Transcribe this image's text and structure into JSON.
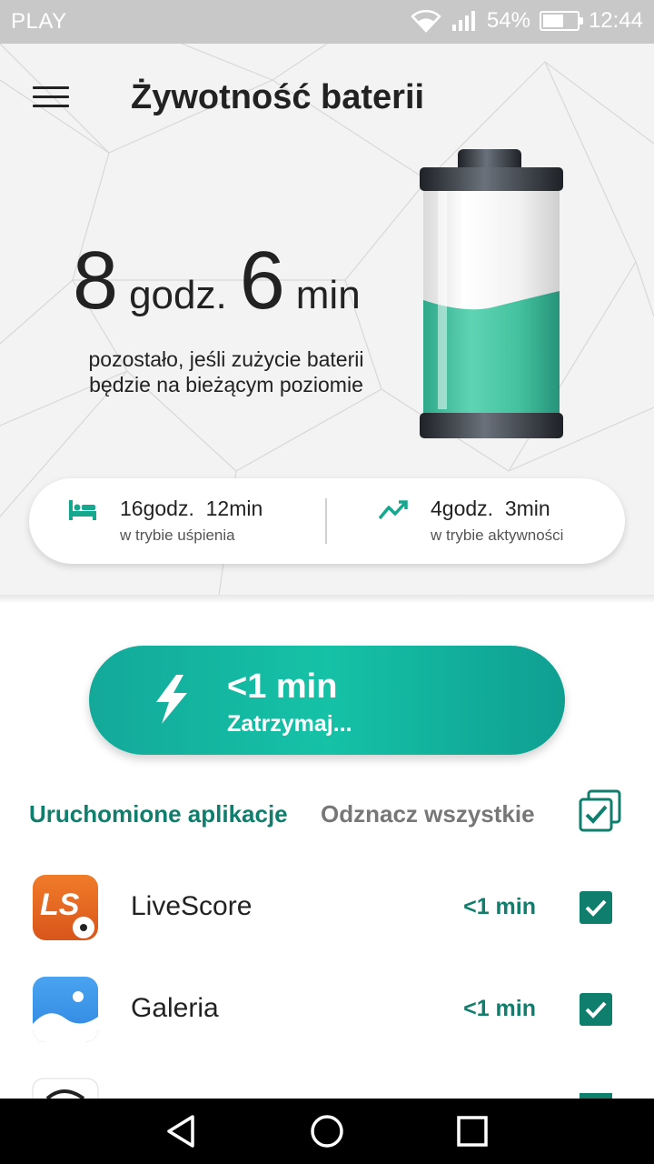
{
  "status_bar": {
    "carrier": "PLAY",
    "battery_percent": "54%",
    "battery_level": 0.54,
    "time": "12:44",
    "icons": [
      "wifi-icon",
      "signal-icon",
      "battery-icon"
    ]
  },
  "header": {
    "menu_icon": "hamburger-menu-icon",
    "title": "Żywotność baterii"
  },
  "remaining": {
    "hours": "8",
    "hours_unit": "godz.",
    "minutes": "6",
    "minutes_unit": "min",
    "description_line1": "pozostało, jeśli zużycie baterii",
    "description_line2": "będzie na bieżącym poziomie",
    "battery_fill_level": 0.45
  },
  "stats": {
    "sleep": {
      "icon": "bed-icon",
      "hours": "16",
      "hours_unit": "godz.",
      "minutes": "12",
      "minutes_unit": "min",
      "label": "w trybie uśpienia"
    },
    "active": {
      "icon": "trend-up-icon",
      "hours": "4",
      "hours_unit": "godz.",
      "minutes": "3",
      "minutes_unit": "min",
      "label": "w trybie aktywności"
    }
  },
  "stop_button": {
    "icon": "lightning-bolt-icon",
    "time": "<1 min",
    "label": "Zatrzymaj..."
  },
  "running_apps": {
    "title": "Uruchomione aplikacje",
    "unselect_all": "Odznacz wszystkie",
    "select_all_checked": true,
    "apps": [
      {
        "name": "LiveScore",
        "time": "<1 min",
        "checked": true,
        "icon": "livescore-app-icon"
      },
      {
        "name": "Galeria",
        "time": "<1 min",
        "checked": true,
        "icon": "gallery-app-icon"
      }
    ]
  },
  "colors": {
    "accent": "#0f7e6c",
    "button_gradient_start": "#13a99a",
    "button_gradient_mid": "#15c2a6",
    "status_bar": "#c8c8c8",
    "hero_bg": "#f3f3f3"
  },
  "nav_bar": {
    "icons": [
      "back-icon",
      "home-icon",
      "recents-icon"
    ]
  }
}
